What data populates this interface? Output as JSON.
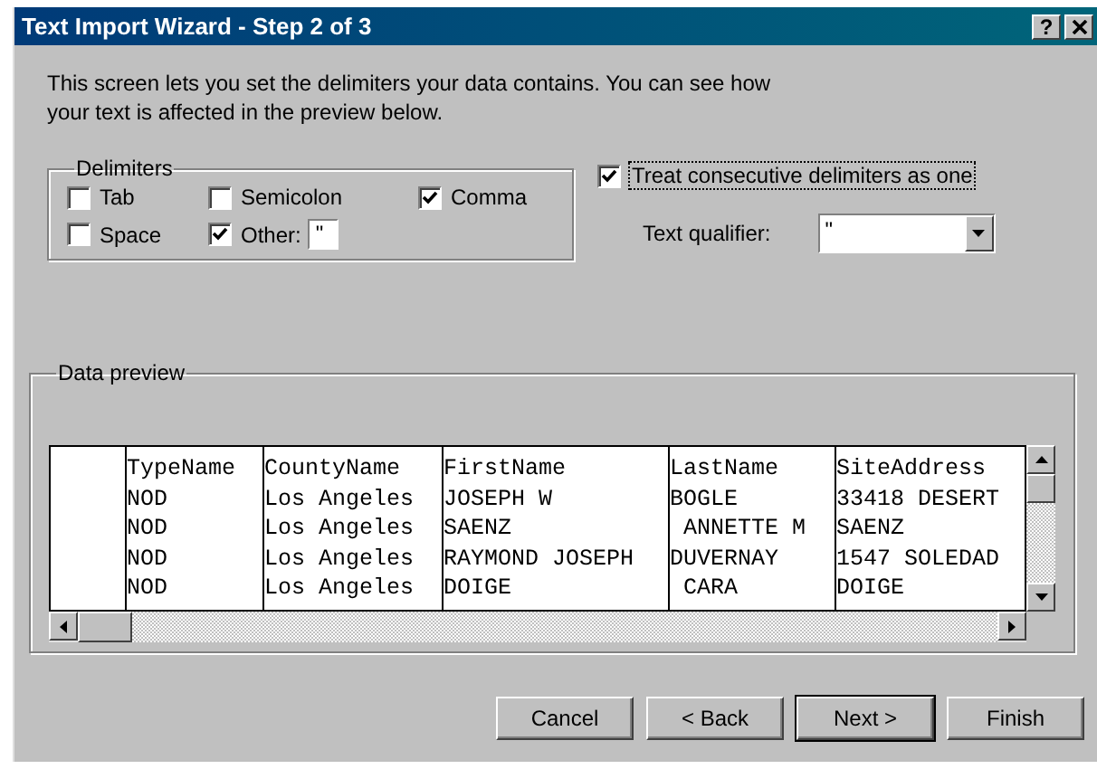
{
  "window": {
    "title": "Text Import Wizard - Step 2 of 3",
    "help_label": "?"
  },
  "intro": "This screen lets you set the delimiters your data contains.  You can see how your text is affected in the preview below.",
  "delimiters": {
    "legend": "Delimiters",
    "options": [
      {
        "kind": "checkbox",
        "label": "Tab",
        "checked": false
      },
      {
        "kind": "checkbox",
        "label": "Semicolon",
        "checked": false
      },
      {
        "kind": "checkbox",
        "label": "Comma",
        "checked": true
      },
      {
        "kind": "checkbox",
        "label": "Space",
        "checked": false
      },
      {
        "kind": "other",
        "label": "Other:",
        "checked": true,
        "value": "\""
      }
    ]
  },
  "consecutive": {
    "label": "Treat consecutive delimiters as one",
    "checked": true
  },
  "text_qualifier": {
    "label": "Text qualifier:",
    "value": "\""
  },
  "preview": {
    "legend": "Data preview",
    "rows": [
      [
        "TypeName",
        "CountyName",
        "FirstName",
        "LastName",
        "SiteAddress"
      ],
      [
        "NOD",
        "Los Angeles",
        "JOSEPH W",
        "BOGLE",
        "33418 DESERT"
      ],
      [
        "NOD",
        "Los Angeles",
        "SAENZ",
        " ANNETTE M",
        "SAENZ"
      ],
      [
        "NOD",
        "Los Angeles",
        "RAYMOND JOSEPH",
        "DUVERNAY",
        "1547 SOLEDAD"
      ],
      [
        "NOD",
        "Los Angeles",
        "DOIGE",
        " CARA",
        "DOIGE"
      ]
    ]
  },
  "buttons": [
    {
      "label": "Cancel",
      "default": false
    },
    {
      "label": "< Back",
      "default": false
    },
    {
      "label": "Next >",
      "default": true
    },
    {
      "label": "Finish",
      "default": false
    }
  ]
}
